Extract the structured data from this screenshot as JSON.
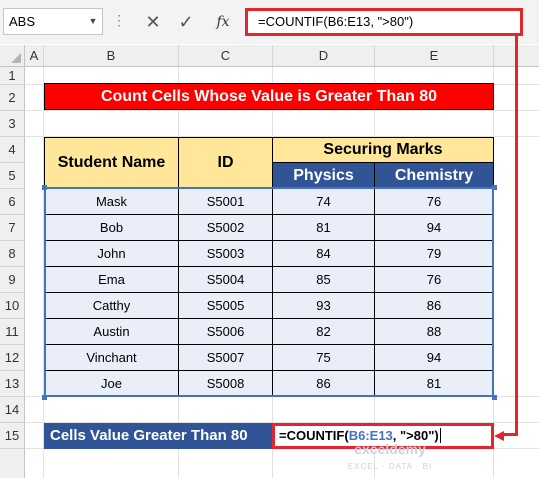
{
  "formula_bar": {
    "name_box": "ABS",
    "name_box_dropdown_icon": "chevron-down-icon",
    "cancel_icon": "close-icon",
    "enter_icon": "check-icon",
    "fx_label": "fx",
    "formula": "=COUNTIF(B6:E13, \">80\")"
  },
  "columns": [
    "A",
    "B",
    "C",
    "D",
    "E"
  ],
  "rows": [
    "1",
    "2",
    "3",
    "4",
    "5",
    "6",
    "7",
    "8",
    "9",
    "10",
    "11",
    "12",
    "13",
    "14",
    "15"
  ],
  "title": "Count Cells Whose Value is Greater Than 80",
  "table": {
    "header_name": "Student Name",
    "header_id": "ID",
    "header_group": "Securing Marks",
    "subheaders": [
      "Physics",
      "Chemistry"
    ],
    "rows": [
      {
        "name": "Mask",
        "id": "S5001",
        "physics": "74",
        "chemistry": "76"
      },
      {
        "name": "Bob",
        "id": "S5002",
        "physics": "81",
        "chemistry": "94"
      },
      {
        "name": "John",
        "id": "S5003",
        "physics": "84",
        "chemistry": "79"
      },
      {
        "name": "Ema",
        "id": "S5004",
        "physics": "85",
        "chemistry": "76"
      },
      {
        "name": "Catthy",
        "id": "S5005",
        "physics": "93",
        "chemistry": "86"
      },
      {
        "name": "Austin",
        "id": "S5006",
        "physics": "82",
        "chemistry": "88"
      },
      {
        "name": "Vinchant",
        "id": "S5007",
        "physics": "75",
        "chemistry": "94"
      },
      {
        "name": "Joe",
        "id": "S5008",
        "physics": "86",
        "chemistry": "81"
      }
    ]
  },
  "summary": {
    "label": "Cells Value Greater Than 80",
    "formula_prefix": "=COUNTIF(",
    "formula_ref": "B6:E13",
    "formula_suffix": ", \">80\")"
  },
  "watermark": {
    "name": "exceldemy",
    "tagline": "EXCEL · DATA · BI"
  },
  "colors": {
    "title_bg": "#fe0000",
    "header_bg": "#ffe699",
    "subheader_bg": "#305496",
    "data_bg": "#e9eef8",
    "highlight": "#e3262d",
    "selection": "#4472c4"
  }
}
